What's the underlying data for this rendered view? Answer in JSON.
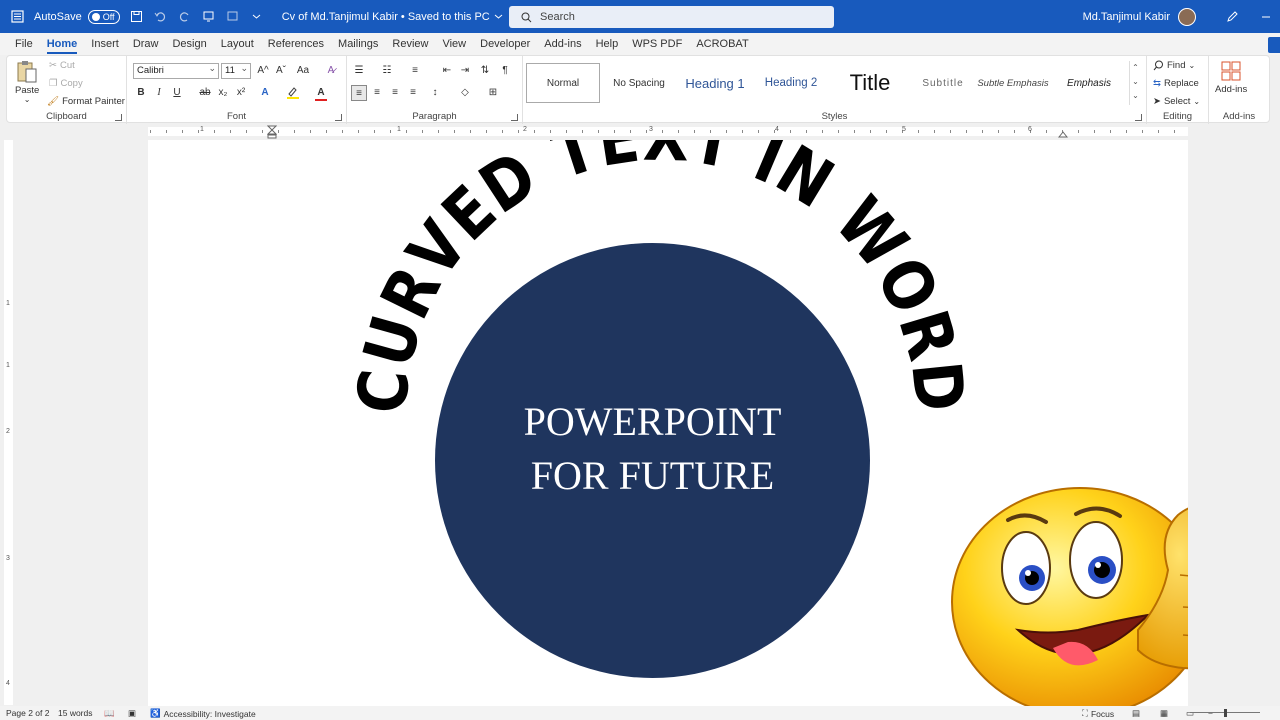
{
  "titlebar": {
    "autosave_label": "AutoSave",
    "autosave_state": "Off",
    "doc_title": "Cv of Md.Tanjimul Kabir • Saved to this PC",
    "search_placeholder": "Search",
    "user_name": "Md.Tanjimul Kabir"
  },
  "tabs": [
    "File",
    "Home",
    "Insert",
    "Draw",
    "Design",
    "Layout",
    "References",
    "Mailings",
    "Review",
    "View",
    "Developer",
    "Add-ins",
    "Help",
    "WPS PDF",
    "ACROBAT"
  ],
  "ribbon": {
    "clipboard": {
      "paste": "Paste",
      "cut": "Cut",
      "copy": "Copy",
      "format_painter": "Format Painter",
      "label": "Clipboard"
    },
    "font": {
      "font_name": "Calibri",
      "font_size": "11",
      "label": "Font",
      "bold": "B",
      "italic": "I",
      "underline": "U",
      "strike": "ab",
      "subscript": "x₂",
      "superscript": "x²",
      "grow": "A^",
      "shrink": "Aˇ",
      "case": "Aa"
    },
    "paragraph": {
      "label": "Paragraph"
    },
    "styles": {
      "label": "Styles",
      "items": [
        "Normal",
        "No Spacing",
        "Heading 1",
        "Heading 2",
        "Title",
        "Subtitle",
        "Subtle Emphasis",
        "Emphasis"
      ]
    },
    "editing": {
      "find": "Find",
      "replace": "Replace",
      "select": "Select",
      "label": "Editing"
    },
    "addins": {
      "button": "Add-ins",
      "label": "Add-ins"
    }
  },
  "ruler": {
    "h_numbers": [
      "1",
      "1",
      "2",
      "3",
      "4",
      "5",
      "6"
    ],
    "v_numbers": [
      "1",
      "1",
      "2",
      "3",
      "4"
    ]
  },
  "document": {
    "curved_text": "CURVED TEXT IN WORD",
    "circle_line1": "POWERPOINT",
    "circle_line2": "FOR FUTURE"
  },
  "colors": {
    "accent": "#185abd",
    "circle": "#1f355e"
  },
  "status": {
    "page": "Page 2 of 2",
    "words": "15 words",
    "accessibility": "Accessibility: Investigate",
    "focus": "Focus"
  }
}
